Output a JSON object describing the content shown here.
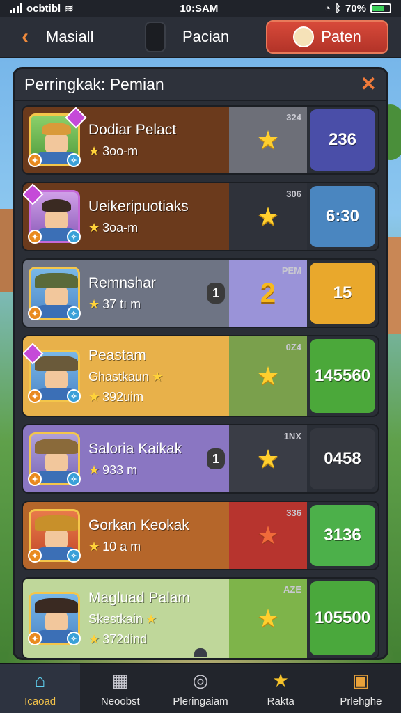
{
  "status": {
    "carrier": "ocbtibl",
    "time": "10:SAM",
    "battery": "70%",
    "battery_level": 0.7
  },
  "header": {
    "back_label": "Masiall",
    "center_label": "Pacian",
    "action_label": "Paten"
  },
  "panel": {
    "title": "Perringkak: Pemian",
    "close": "✕"
  },
  "rows": [
    {
      "name": "Dodiar Pelact",
      "sub": "3oo-m",
      "mid_code": "324",
      "score": "236",
      "theme": {
        "main": "#6b3a1c",
        "mid": "#6d6f78",
        "score": "#4a4ea8"
      },
      "star": "star"
    },
    {
      "name": "Ueikeripuotiaks",
      "sub": "3oa-m",
      "mid_code": "306",
      "score": "6:30",
      "theme": {
        "main": "#6b3a1c",
        "mid": "#2f323a",
        "score": "#4a86c0"
      },
      "star": "star"
    },
    {
      "name": "Remnshar",
      "sub": "37 tı m",
      "rank_chip": "1",
      "mid_code": "PEM",
      "mid_number": "2",
      "score": "15",
      "theme": {
        "main": "#6e7484",
        "mid": "#9a93d8",
        "score": "#e9a82c"
      }
    },
    {
      "name": "Peastam",
      "name2": "Ghastkaun",
      "sub": "392uim",
      "mid_code": "0Z4",
      "score": "145560",
      "theme": {
        "main": "#e8b14a",
        "mid": "#7aa04c",
        "score": "#4ba83a"
      },
      "star": "star"
    },
    {
      "name": "Saloria Kaikak",
      "sub": "933 m",
      "rank_chip": "1",
      "mid_code": "1NX",
      "score": "0458",
      "theme": {
        "main": "#8a76c2",
        "mid": "#3a3d46",
        "score": "#34373f"
      },
      "star": "star"
    },
    {
      "name": "Gorkan Keokak",
      "sub": "10 a m",
      "mid_code": "336",
      "score": "3136",
      "theme": {
        "main": "#b5662a",
        "mid": "#b7342e",
        "score": "#4cb04a"
      },
      "star": "red"
    },
    {
      "name": "Magluad Palam",
      "name2": "Skestkain",
      "sub": "372dind",
      "mid_code": "AZE",
      "score": "105500",
      "theme": {
        "main": "#bfd79a",
        "mid": "#7eb44a",
        "score": "#4aa83c"
      },
      "star": "star"
    }
  ],
  "bottom_nav": [
    {
      "label": "Icaoad",
      "icon": "home-icon",
      "glyph": "⌂",
      "color": "#5fd0f0"
    },
    {
      "label": "Neoobst",
      "icon": "cards-icon",
      "glyph": "▦",
      "color": "#c8c8d0"
    },
    {
      "label": "Pleringaiam",
      "icon": "ranking-icon",
      "glyph": "◎",
      "color": "#c8c8d0"
    },
    {
      "label": "Rakta",
      "icon": "star-badge-icon",
      "glyph": "★",
      "color": "#f6c32a"
    },
    {
      "label": "Prlehghe",
      "icon": "chest-icon",
      "glyph": "▣",
      "color": "#e9a23a"
    }
  ]
}
